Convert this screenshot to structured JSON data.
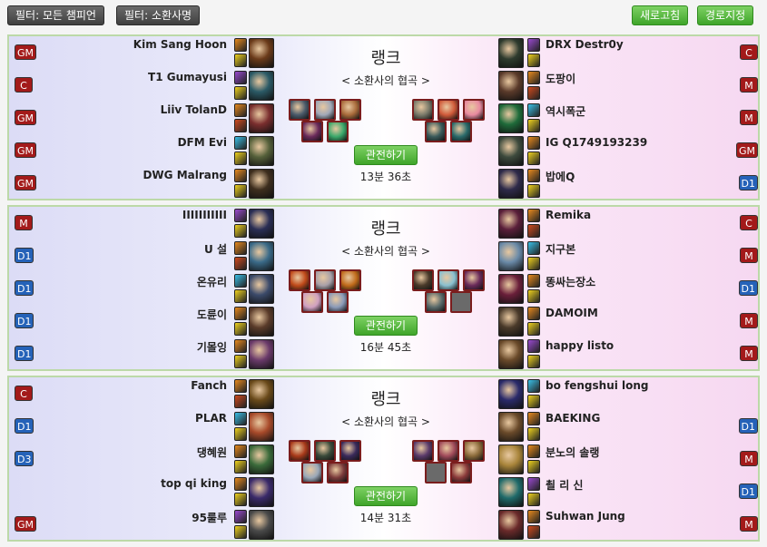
{
  "toolbar": {
    "filter_champion": "필터: 모든 챔피언",
    "filter_summoner": "필터: 소환사명",
    "refresh": "새로고침",
    "set_path": "경로지정"
  },
  "matches": [
    {
      "mode": "랭크",
      "map": "< 소환사의 협곡 >",
      "watch_label": "관전하기",
      "duration": "13분 36초",
      "blue_team": [
        {
          "name": "Kim Sang Hoon",
          "tier": "GM",
          "tier_color": "red"
        },
        {
          "name": "T1 Gumayusi",
          "tier": "C",
          "tier_color": "red"
        },
        {
          "name": "Liiv TolanD",
          "tier": "GM",
          "tier_color": "red"
        },
        {
          "name": "DFM Evi",
          "tier": "GM",
          "tier_color": "red"
        },
        {
          "name": "DWG Malrang",
          "tier": "GM",
          "tier_color": "red"
        }
      ],
      "red_team": [
        {
          "name": "DRX Destr0y",
          "tier": "C",
          "tier_color": "red"
        },
        {
          "name": "도팡이",
          "tier": "M",
          "tier_color": "red"
        },
        {
          "name": "역시폭군",
          "tier": "M",
          "tier_color": "red"
        },
        {
          "name": "IG Q1749193239",
          "tier": "GM",
          "tier_color": "red"
        },
        {
          "name": "밥에Q",
          "tier": "D1",
          "tier_color": "blue"
        }
      ]
    },
    {
      "mode": "랭크",
      "map": "< 소환사의 협곡 >",
      "watch_label": "관전하기",
      "duration": "16분 45초",
      "blue_team": [
        {
          "name": "IIIIIIIIIII",
          "tier": "M",
          "tier_color": "red"
        },
        {
          "name": "U 설",
          "tier": "D1",
          "tier_color": "blue"
        },
        {
          "name": "온유리",
          "tier": "D1",
          "tier_color": "blue"
        },
        {
          "name": "도륜이",
          "tier": "D1",
          "tier_color": "blue"
        },
        {
          "name": "기몰잉",
          "tier": "D1",
          "tier_color": "blue"
        }
      ],
      "red_team": [
        {
          "name": "Remika",
          "tier": "C",
          "tier_color": "red"
        },
        {
          "name": "지구본",
          "tier": "M",
          "tier_color": "red"
        },
        {
          "name": "똥싸는장소",
          "tier": "D1",
          "tier_color": "blue"
        },
        {
          "name": "DAMOIM",
          "tier": "M",
          "tier_color": "red"
        },
        {
          "name": "happy listo",
          "tier": "M",
          "tier_color": "red"
        }
      ]
    },
    {
      "mode": "랭크",
      "map": "< 소환사의 협곡 >",
      "watch_label": "관전하기",
      "duration": "14분 31초",
      "blue_team": [
        {
          "name": "Fanch",
          "tier": "C",
          "tier_color": "red"
        },
        {
          "name": "PLAR",
          "tier": "D1",
          "tier_color": "blue"
        },
        {
          "name": "댕혜원",
          "tier": "D3",
          "tier_color": "blue"
        },
        {
          "name": "top qi king",
          "tier": "",
          "tier_color": "none"
        },
        {
          "name": "95룰루",
          "tier": "GM",
          "tier_color": "red"
        }
      ],
      "red_team": [
        {
          "name": "bo fengshui long",
          "tier": "",
          "tier_color": "none"
        },
        {
          "name": "BAEKING",
          "tier": "D1",
          "tier_color": "blue"
        },
        {
          "name": "분노의 솔랭",
          "tier": "M",
          "tier_color": "red"
        },
        {
          "name": "쵤 리 신",
          "tier": "D1",
          "tier_color": "blue"
        },
        {
          "name": "Suhwan Jung",
          "tier": "M",
          "tier_color": "red"
        }
      ]
    }
  ]
}
